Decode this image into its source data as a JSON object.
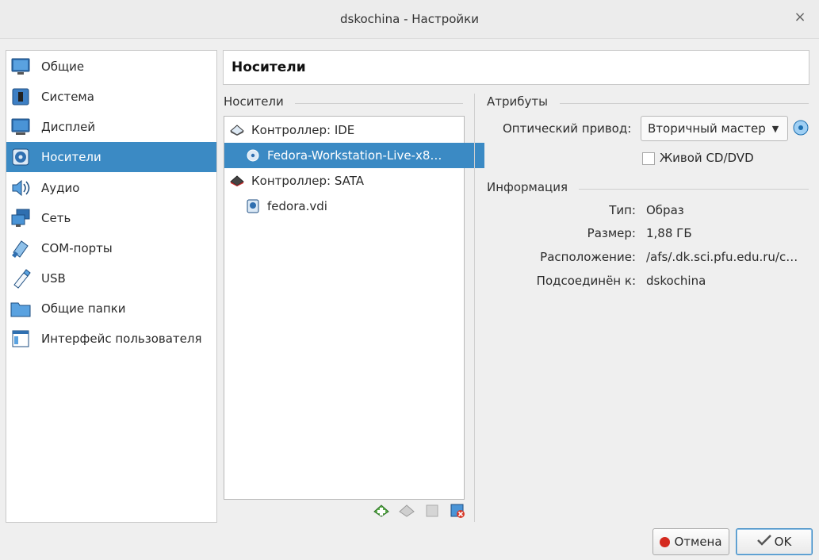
{
  "window": {
    "title": "dskochina - Настройки",
    "close": "×"
  },
  "sidebar": {
    "items": [
      {
        "label": "Общие",
        "icon": "monitor-icon"
      },
      {
        "label": "Система",
        "icon": "chip-icon"
      },
      {
        "label": "Дисплей",
        "icon": "display-icon"
      },
      {
        "label": "Носители",
        "icon": "storage-disc-icon",
        "active": true
      },
      {
        "label": "Аудио",
        "icon": "speaker-icon"
      },
      {
        "label": "Сеть",
        "icon": "network-icon"
      },
      {
        "label": "COM-порты",
        "icon": "serial-port-icon"
      },
      {
        "label": "USB",
        "icon": "usb-icon"
      },
      {
        "label": "Общие папки",
        "icon": "folder-icon"
      },
      {
        "label": "Интерфейс пользователя",
        "icon": "ui-window-icon"
      }
    ]
  },
  "page": {
    "title": "Носители"
  },
  "storage": {
    "group_label": "Носители",
    "tree": [
      {
        "label": "Контроллер: IDE",
        "type": "controller"
      },
      {
        "label": "Fedora-Workstation-Live-x8…",
        "type": "optical",
        "selected": true
      },
      {
        "label": "Контроллер: SATA",
        "type": "controller"
      },
      {
        "label": "fedora.vdi",
        "type": "disk"
      }
    ]
  },
  "attributes": {
    "group_label": "Атрибуты",
    "optical_drive_label": "Оптический привод:",
    "optical_drive_value": "Вторичный мастер",
    "live_cd_label": "Живой CD/DVD",
    "live_cd_checked": false
  },
  "info": {
    "group_label": "Информация",
    "rows": [
      {
        "key": "Тип:",
        "value": "Образ"
      },
      {
        "key": "Размер:",
        "value": "1,88 ГБ"
      },
      {
        "key": "Расположение:",
        "value": "/afs/.dk.sci.pfu.edu.ru/c…"
      },
      {
        "key": "Подсоединён к:",
        "value": "dskochina"
      }
    ]
  },
  "buttons": {
    "cancel": "Отмена",
    "ok": "OK"
  },
  "colors": {
    "selection": "#3b8ac4",
    "background": "#efefef"
  }
}
